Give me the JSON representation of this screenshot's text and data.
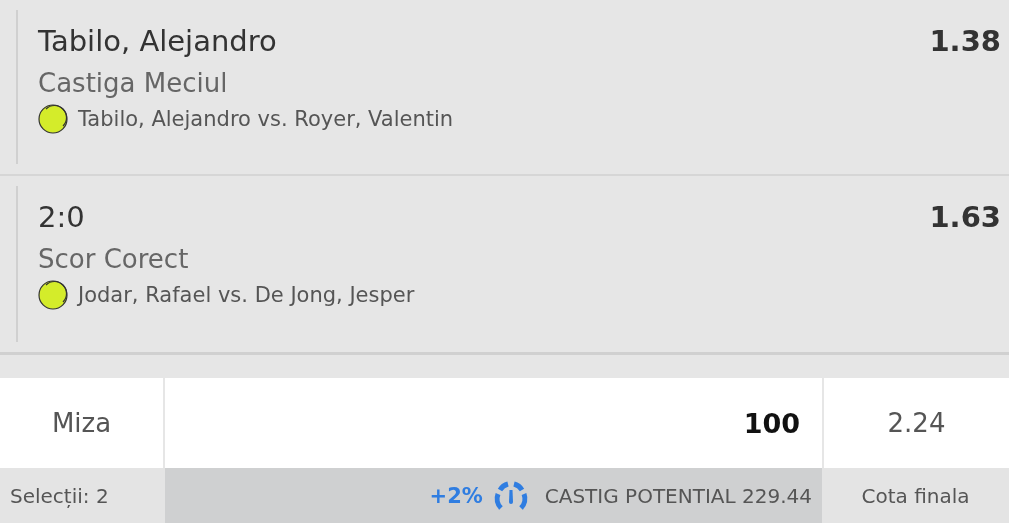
{
  "selections": [
    {
      "selection": "Tabilo, Alejandro",
      "odds": "1.38",
      "market": "Castiga Meciul",
      "event": "Tabilo, Alejandro vs. Royer, Valentin"
    },
    {
      "selection": "2:0",
      "odds": "1.63",
      "market": "Scor Corect",
      "event": "Jodar, Rafael vs. De Jong, Jesper"
    }
  ],
  "stake": {
    "label": "Miza",
    "value": "100",
    "total_odds": "2.24"
  },
  "footer": {
    "selections_count": "Selecții: 2",
    "boost": "+2%",
    "potential_win": "CASTIG POTENTIAL 229.44",
    "total_odds_label": "Cota finala"
  }
}
